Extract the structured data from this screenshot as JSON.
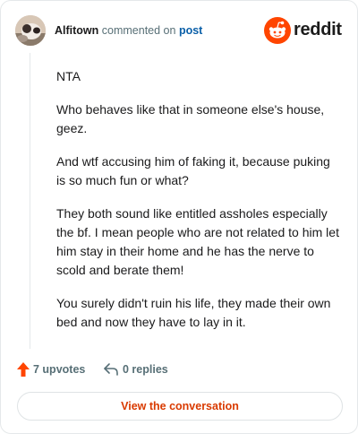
{
  "header": {
    "username": "Alfitown",
    "action_text": "commented on",
    "post_link": "post",
    "brand": "reddit"
  },
  "comment": {
    "paragraphs": [
      "NTA",
      "Who behaves like that in someone else's house, geez.",
      "And wtf accusing him of faking it, because puking is so much fun or what?",
      "They both sound like entitled assholes especially the bf. I mean people who are not related to him let him stay in their home and he has the nerve to scold and berate them!",
      "You surely didn't ruin his life, they made their own bed and now they have to lay in it."
    ]
  },
  "actions": {
    "upvotes_label": "7 upvotes",
    "replies_label": "0 replies"
  },
  "cta": {
    "label": "View the conversation"
  },
  "colors": {
    "accent": "#d93a00",
    "upvote": "#ff4500",
    "link": "#0a5fa8",
    "muted": "#576f76"
  },
  "icons": {
    "avatar": "avatar",
    "brand": "reddit-snoo-icon",
    "upvote": "upvote-arrow-icon",
    "reply": "reply-arrow-icon"
  }
}
